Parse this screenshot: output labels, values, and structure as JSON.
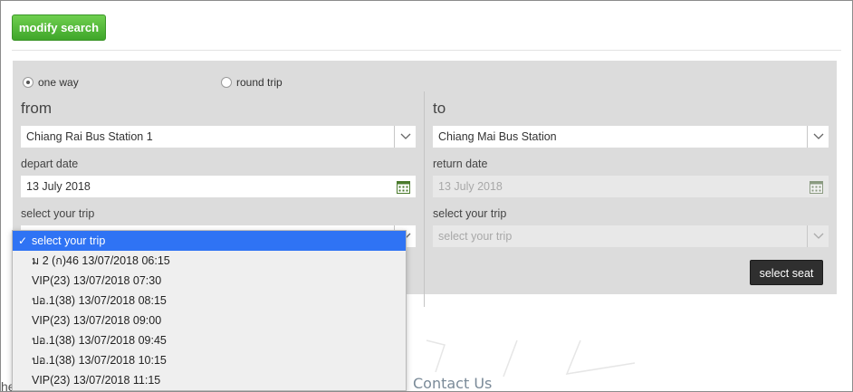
{
  "toolbar": {
    "modify_label": "modify search"
  },
  "trip_type": {
    "one_way_label": "one way",
    "round_trip_label": "round trip",
    "selected": "one way"
  },
  "from": {
    "title": "from",
    "station": "Chiang Rai Bus Station 1",
    "depart_label": "depart date",
    "depart_date": "13 July 2018",
    "trip_label": "select your trip"
  },
  "to": {
    "title": "to",
    "station": "Chiang Mai Bus Station",
    "return_label": "return date",
    "return_date": "13 July 2018",
    "trip_label": "select your trip",
    "trip_placeholder": "select your trip"
  },
  "actions": {
    "select_seat_label": "select seat"
  },
  "trip_dropdown": {
    "check": "✓",
    "options": [
      "select your trip",
      "ม 2 (ก)46 13/07/2018 06:15",
      "VIP(23) 13/07/2018 07:30",
      "ปอ.1(38) 13/07/2018 08:15",
      "VIP(23) 13/07/2018 09:00",
      "ปอ.1(38) 13/07/2018 09:45",
      "ปอ.1(38) 13/07/2018 10:15",
      "VIP(23) 13/07/2018 11:15"
    ]
  },
  "footer": {
    "partial_text": "he",
    "contact_label": "Contact Us"
  },
  "colors": {
    "accent_green": "#4cb534",
    "highlight_blue": "#2f73f4",
    "panel_gray": "#dcdcdc",
    "dark_button": "#2f2f2f"
  },
  "icons": {
    "calendar": "calendar-icon",
    "chevron": "chevron-down-icon",
    "check": "check-icon"
  }
}
